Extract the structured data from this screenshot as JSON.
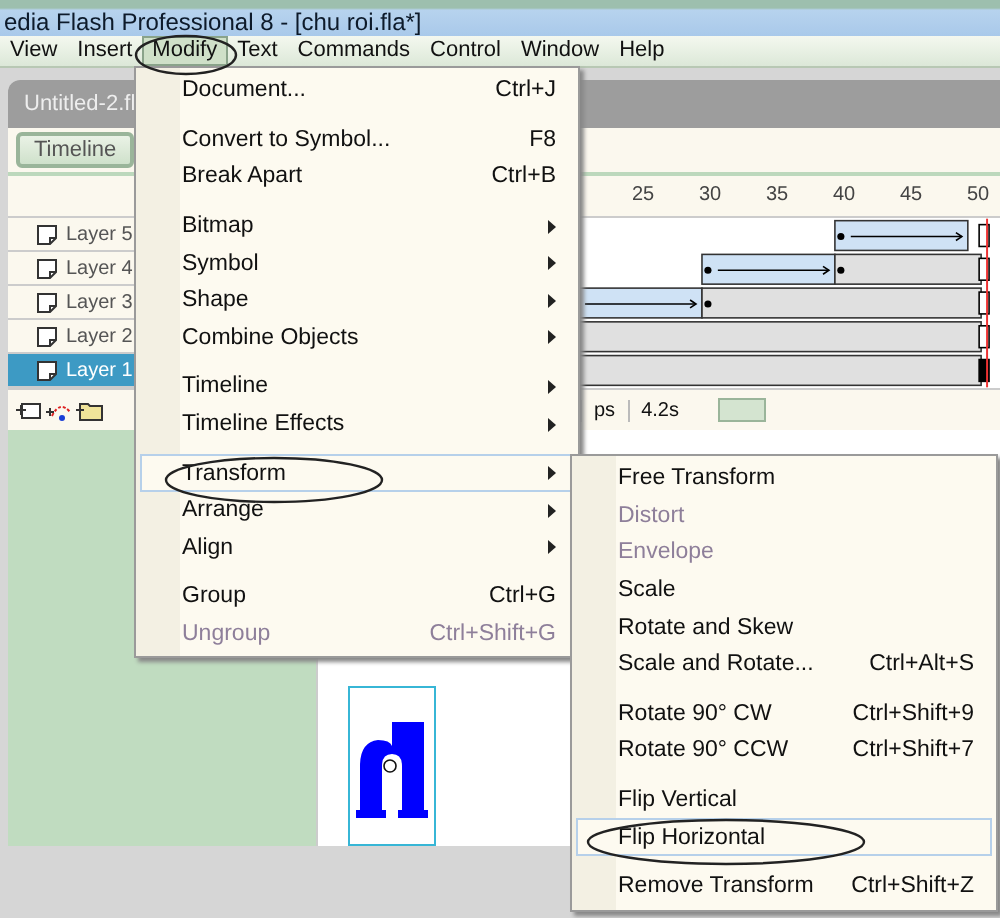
{
  "window": {
    "title": "edia Flash Professional 8 - [chu roi.fla*]"
  },
  "menubar": [
    {
      "label": "View",
      "selected": false
    },
    {
      "label": "Insert",
      "selected": false
    },
    {
      "label": "Modify",
      "selected": true
    },
    {
      "label": "Text",
      "selected": false
    },
    {
      "label": "Commands",
      "selected": false
    },
    {
      "label": "Control",
      "selected": false
    },
    {
      "label": "Window",
      "selected": false
    },
    {
      "label": "Help",
      "selected": false
    }
  ],
  "document_tab": "Untitled-2.fl",
  "timeline": {
    "button": "Timeline",
    "ruler": [
      "25",
      "30",
      "35",
      "40",
      "45",
      "50"
    ],
    "layers": [
      {
        "name": "Layer 5",
        "selected": false
      },
      {
        "name": "Layer 4",
        "selected": false
      },
      {
        "name": "Layer 3",
        "selected": false
      },
      {
        "name": "Layer 2",
        "selected": false
      },
      {
        "name": "Layer 1",
        "selected": true
      }
    ],
    "status": [
      "ps",
      "4.2s"
    ]
  },
  "menu": [
    {
      "kind": "item",
      "label": "Document...",
      "shortcut": "Ctrl+J",
      "submenu": false,
      "disabled": false,
      "selected": false
    },
    {
      "kind": "separator"
    },
    {
      "kind": "item",
      "label": "Convert to Symbol...",
      "shortcut": "F8",
      "submenu": false,
      "disabled": false,
      "selected": false
    },
    {
      "kind": "item",
      "label": "Break Apart",
      "shortcut": "Ctrl+B",
      "submenu": false,
      "disabled": false,
      "selected": false
    },
    {
      "kind": "separator"
    },
    {
      "kind": "item",
      "label": "Bitmap",
      "submenu": true,
      "disabled": false,
      "selected": false
    },
    {
      "kind": "item",
      "label": "Symbol",
      "submenu": true,
      "disabled": false,
      "selected": false
    },
    {
      "kind": "item",
      "label": "Shape",
      "submenu": true,
      "disabled": false,
      "selected": false
    },
    {
      "kind": "item",
      "label": "Combine Objects",
      "submenu": true,
      "disabled": false,
      "selected": false
    },
    {
      "kind": "separator"
    },
    {
      "kind": "item",
      "label": "Timeline",
      "submenu": true,
      "disabled": false,
      "selected": false
    },
    {
      "kind": "item",
      "label": "Timeline Effects",
      "submenu": true,
      "disabled": false,
      "selected": false
    },
    {
      "kind": "separator"
    },
    {
      "kind": "item",
      "label": "Transform",
      "submenu": true,
      "disabled": false,
      "selected": true
    },
    {
      "kind": "item",
      "label": "Arrange",
      "submenu": true,
      "disabled": false,
      "selected": false
    },
    {
      "kind": "item",
      "label": "Align",
      "submenu": true,
      "disabled": false,
      "selected": false
    },
    {
      "kind": "separator"
    },
    {
      "kind": "item",
      "label": "Group",
      "shortcut": "Ctrl+G",
      "submenu": false,
      "disabled": false,
      "selected": false
    },
    {
      "kind": "item",
      "label": "Ungroup",
      "shortcut": "Ctrl+Shift+G",
      "submenu": false,
      "disabled": true,
      "selected": false
    }
  ],
  "submenu": [
    {
      "kind": "item",
      "label": "Free Transform",
      "disabled": false,
      "selected": false
    },
    {
      "kind": "item",
      "label": "Distort",
      "disabled": true,
      "selected": false
    },
    {
      "kind": "item",
      "label": "Envelope",
      "disabled": true,
      "selected": false
    },
    {
      "kind": "item",
      "label": "Scale",
      "disabled": false,
      "selected": false
    },
    {
      "kind": "item",
      "label": "Rotate and Skew",
      "disabled": false,
      "selected": false
    },
    {
      "kind": "item",
      "label": "Scale and Rotate...",
      "shortcut": "Ctrl+Alt+S",
      "disabled": false,
      "selected": false
    },
    {
      "kind": "separator"
    },
    {
      "kind": "item",
      "label": "Rotate 90° CW",
      "shortcut": "Ctrl+Shift+9",
      "disabled": false,
      "selected": false
    },
    {
      "kind": "item",
      "label": "Rotate 90° CCW",
      "shortcut": "Ctrl+Shift+7",
      "disabled": false,
      "selected": false
    },
    {
      "kind": "separator"
    },
    {
      "kind": "item",
      "label": "Flip Vertical",
      "disabled": false,
      "selected": false
    },
    {
      "kind": "item",
      "label": "Flip Horizontal",
      "disabled": false,
      "selected": true
    },
    {
      "kind": "separator"
    },
    {
      "kind": "item",
      "label": "Remove Transform",
      "shortcut": "Ctrl+Shift+Z",
      "disabled": false,
      "selected": false
    }
  ]
}
